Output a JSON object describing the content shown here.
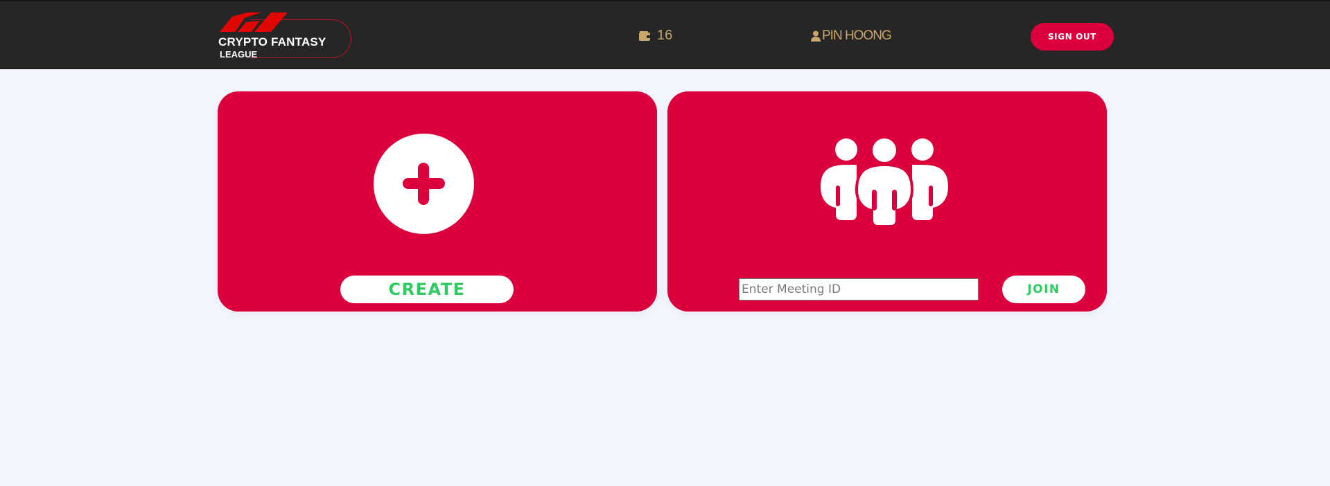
{
  "header": {
    "logo_line1": "CRYPTO FANTASY",
    "logo_line2": "LEAGUE",
    "wallet_icon": "wallet-icon",
    "wallet_balance": "16",
    "user_icon": "user-icon",
    "user_name": "PIN HOONG",
    "signout_label": "SIGN OUT"
  },
  "create_card": {
    "icon": "plus-icon",
    "button_label": "CREATE"
  },
  "join_card": {
    "icon": "group-icon",
    "input_value": "",
    "input_placeholder": "Enter Meeting ID",
    "button_label": "JOIN"
  },
  "colors": {
    "header_bg": "#262626",
    "accent_red": "#dc003c",
    "gold_text": "#c9a66b",
    "button_text_green": "#2ecc5f",
    "page_bg": "#f3f6fe"
  }
}
